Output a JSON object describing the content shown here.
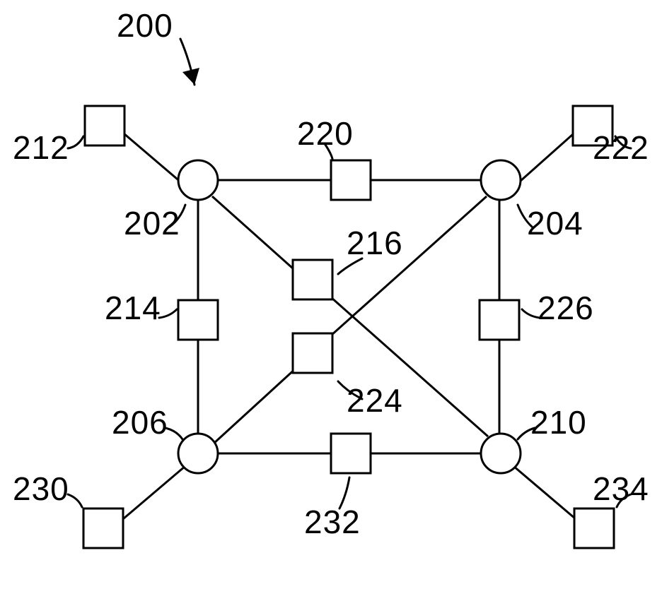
{
  "title": "200",
  "labels": {
    "l200": "200",
    "l202": "202",
    "l204": "204",
    "l206": "206",
    "l210": "210",
    "l212": "212",
    "l214": "214",
    "l216": "216",
    "l220": "220",
    "l222": "222",
    "l224": "224",
    "l226": "226",
    "l230": "230",
    "l232": "232",
    "l234": "234"
  },
  "chart_data": {
    "type": "diagram",
    "title": "Factor / Tanner-style graph 200",
    "variable_nodes": [
      {
        "id": 202,
        "shape": "circle"
      },
      {
        "id": 204,
        "shape": "circle"
      },
      {
        "id": 206,
        "shape": "circle"
      },
      {
        "id": 210,
        "shape": "circle"
      }
    ],
    "check_nodes": [
      {
        "id": 212,
        "shape": "square"
      },
      {
        "id": 214,
        "shape": "square"
      },
      {
        "id": 216,
        "shape": "square"
      },
      {
        "id": 220,
        "shape": "square"
      },
      {
        "id": 222,
        "shape": "square"
      },
      {
        "id": 224,
        "shape": "square"
      },
      {
        "id": 226,
        "shape": "square"
      },
      {
        "id": 230,
        "shape": "square"
      },
      {
        "id": 232,
        "shape": "square"
      },
      {
        "id": 234,
        "shape": "square"
      }
    ],
    "edges": [
      [
        202,
        212
      ],
      [
        202,
        220
      ],
      [
        204,
        220
      ],
      [
        204,
        222
      ],
      [
        202,
        214
      ],
      [
        206,
        214
      ],
      [
        202,
        216
      ],
      [
        210,
        216
      ],
      [
        204,
        224
      ],
      [
        206,
        224
      ],
      [
        204,
        226
      ],
      [
        210,
        226
      ],
      [
        206,
        230
      ],
      [
        206,
        232
      ],
      [
        210,
        232
      ],
      [
        210,
        234
      ]
    ]
  }
}
